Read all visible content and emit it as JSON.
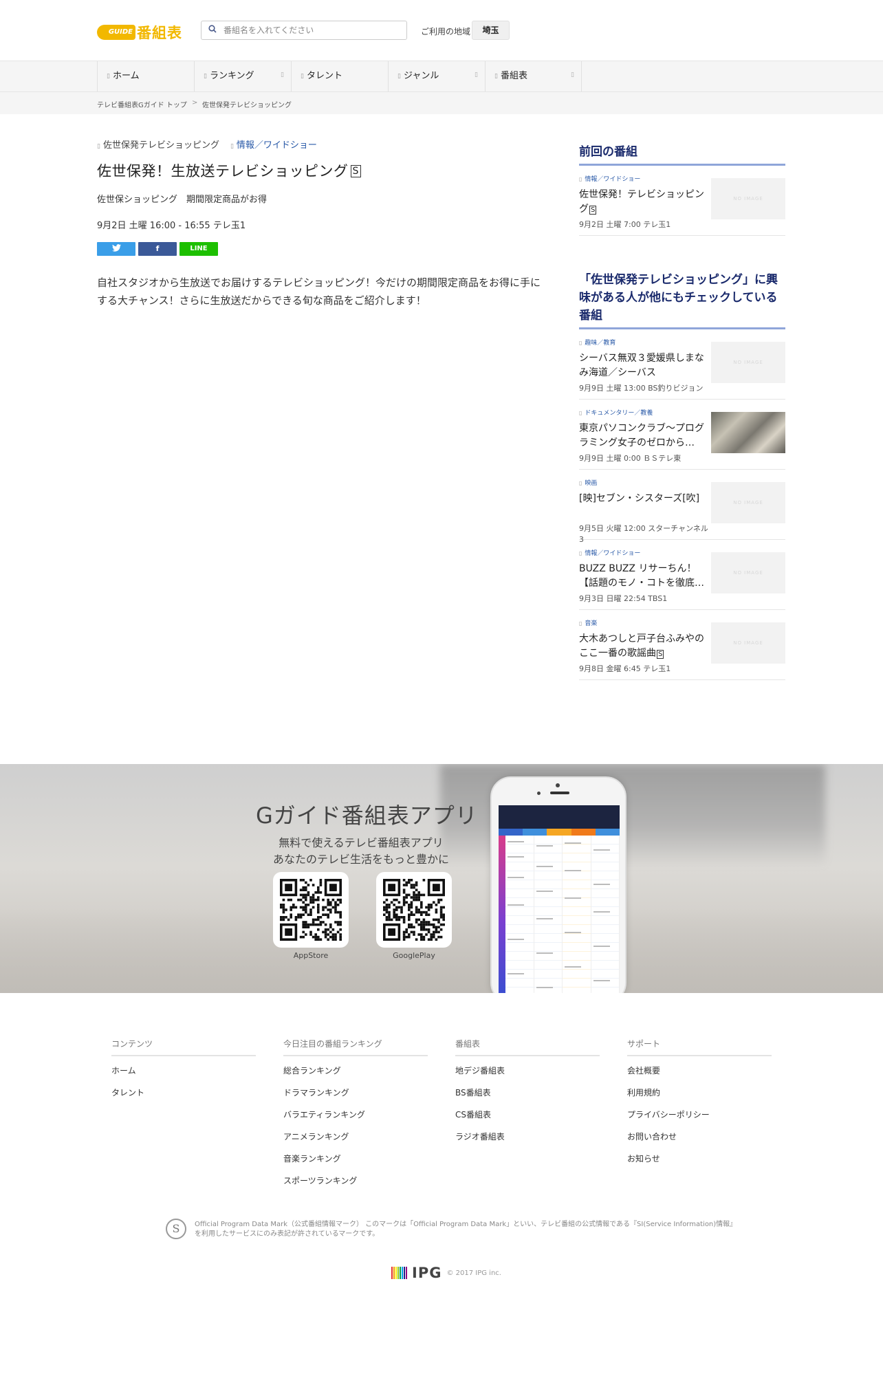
{
  "header": {
    "logo_badge": "GUIDE",
    "logo_text": "番組表",
    "search_icon": "search-icon",
    "search_placeholder": "番組名を入れてください",
    "region_label": "ご利用の地域",
    "region_value": "埼玉"
  },
  "nav": {
    "items": [
      {
        "label": "ホーム",
        "has_dropdown": false
      },
      {
        "label": "ランキング",
        "has_dropdown": true
      },
      {
        "label": "タレント",
        "has_dropdown": false
      },
      {
        "label": "ジャンル",
        "has_dropdown": true
      },
      {
        "label": "番組表",
        "has_dropdown": true
      }
    ]
  },
  "breadcrumb": {
    "home": "テレビ番組表Gガイド トップ",
    "separator": ">",
    "current": "佐世保発テレビショッピング"
  },
  "program": {
    "series": "佐世保発テレビショッピング",
    "genre": "情報／ワイドショー",
    "title": "佐世保発！生放送テレビショッピング",
    "title_mark": "S",
    "subtitle": "佐世保ショッピング　期間限定商品がお得",
    "airtime": "9月2日 土曜 16:00 ‐ 16:55 テレ玉1",
    "share": {
      "twitter": "twitter-icon",
      "facebook": "f",
      "line": "LINE"
    },
    "description": "自社スタジオから生放送でお届けするテレビショッピング！今だけの期間限定商品をお得に手にする大チャンス！さらに生放送だからできる旬な商品をご紹介します！"
  },
  "sidebar": {
    "prev_heading": "前回の番組",
    "prev": [
      {
        "genre": "情報／ワイドショー",
        "title": "佐世保発！テレビショッピング",
        "mark": "S",
        "meta": "9月2日 土曜 7:00 テレ玉1",
        "thumb": "NO IMAGE",
        "photo": false
      }
    ],
    "related_heading": "「佐世保発テレビショッピング」に興味がある人が他にもチェックしている番組",
    "related": [
      {
        "genre": "趣味／教育",
        "title": "シーバス無双３愛媛県しまなみ海道／シーバス",
        "mark": "",
        "meta": "9月9日 土曜 13:00 BS釣りビジョン",
        "thumb": "NO IMAGE",
        "photo": false
      },
      {
        "genre": "ドキュメンタリー／教養",
        "title": "東京パソコンクラブ～プログラミング女子のゼロから…",
        "mark": "",
        "meta": "9月9日 土曜 0:00 ＢＳテレ東",
        "thumb": "",
        "photo": true
      },
      {
        "genre": "映画",
        "title": "[映]セブン・シスターズ[吹]",
        "mark": "",
        "meta": "9月5日 火曜 12:00 スターチャンネル3",
        "thumb": "NO IMAGE",
        "photo": false
      },
      {
        "genre": "情報／ワイドショー",
        "title": "BUZZ BUZZ リサーちん！【話題のモノ・コトを徹底…",
        "mark": "",
        "meta": "9月3日 日曜 22:54 TBS1",
        "thumb": "NO IMAGE",
        "photo": false
      },
      {
        "genre": "音楽",
        "title": "大木あつしと戸子台ふみやのここ一番の歌謡曲",
        "mark": "S",
        "meta": "9月8日 金曜 6:45 テレ玉1",
        "thumb": "NO IMAGE",
        "photo": false
      }
    ]
  },
  "promo": {
    "title": "Gガイド番組表アプリ",
    "line1": "無料で使えるテレビ番組表アプリ",
    "line2": "あなたのテレビ生活をもっと豊かに",
    "appstore": "AppStore",
    "googleplay": "GooglePlay"
  },
  "footer": {
    "columns": [
      {
        "heading": "コンテンツ",
        "links": [
          "ホーム",
          "タレント"
        ]
      },
      {
        "heading": "今日注目の番組ランキング",
        "links": [
          "総合ランキング",
          "ドラマランキング",
          "バラエティランキング",
          "アニメランキング",
          "音楽ランキング",
          "スポーツランキング"
        ]
      },
      {
        "heading": "番組表",
        "links": [
          "地デジ番組表",
          "BS番組表",
          "CS番組表",
          "ラジオ番組表"
        ]
      },
      {
        "heading": "サポート",
        "links": [
          "会社概要",
          "利用規約",
          "プライバシーポリシー",
          "お問い合わせ",
          "お知らせ"
        ]
      }
    ],
    "opdm_seal": "S",
    "opdm_text": "Official Program Data Mark（公式番組情報マーク） このマークは「Official Program Data Mark」といい、テレビ番組の公式情報である『SI(Service Information)情報』を利用したサービスにのみ表記が許されているマークです。",
    "ipg_word": "IPG",
    "copyright": "© 2017 IPG inc.",
    "ipg_colors": [
      "#e6332a",
      "#f39800",
      "#fff100",
      "#8fc31f",
      "#009944",
      "#00a0e9",
      "#1d2088",
      "#920783"
    ]
  }
}
